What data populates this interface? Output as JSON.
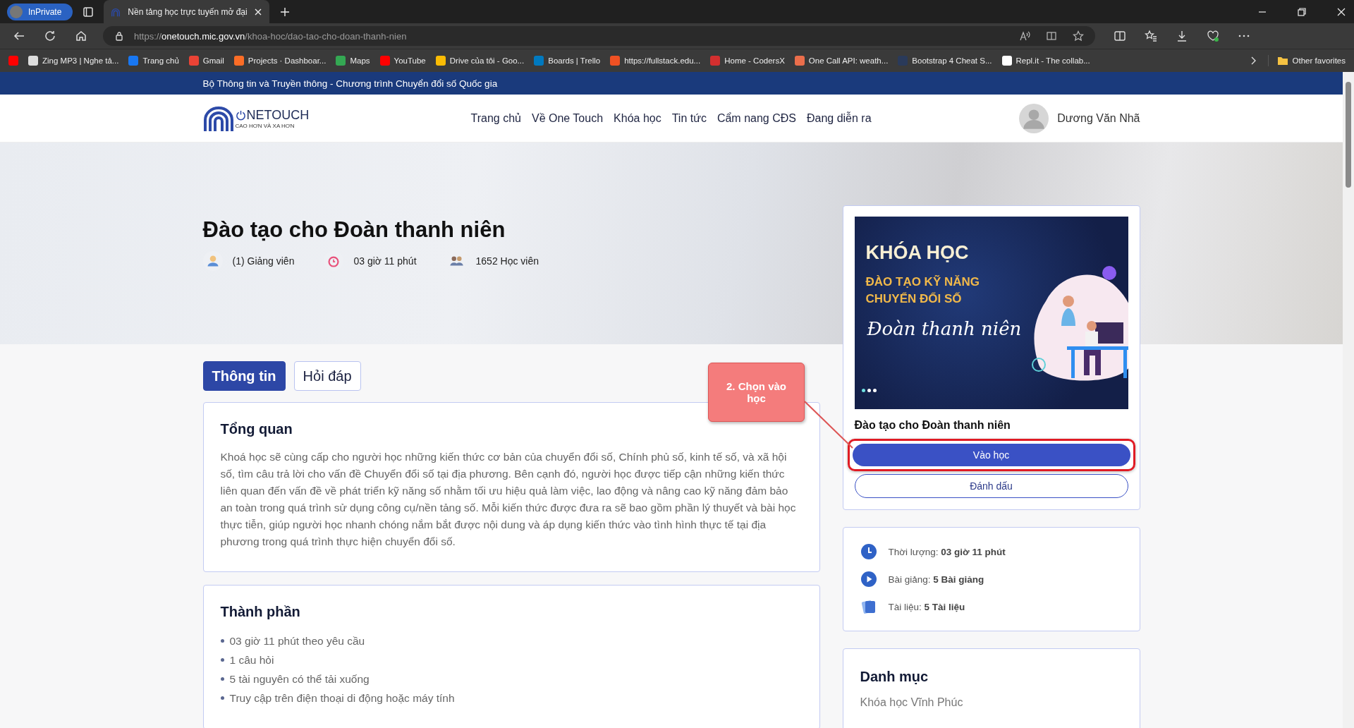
{
  "browser": {
    "private_label": "InPrivate",
    "tab_title": "Nền tảng học trực tuyến mở đại",
    "url_scheme": "https://",
    "url_host": "onetouch.mic.gov.vn",
    "url_path": "/khoa-hoc/dao-tao-cho-doan-thanh-nien",
    "bookmarks": [
      {
        "kind": "youtube"
      },
      {
        "kind": "page",
        "label": "Zing MP3 | Nghe tả..."
      },
      {
        "kind": "facebook",
        "label": "Trang chủ"
      },
      {
        "kind": "gmail",
        "label": "Gmail"
      },
      {
        "kind": "gitlab",
        "label": "Projects · Dashboar..."
      },
      {
        "kind": "maps",
        "label": "Maps"
      },
      {
        "kind": "youtube",
        "label": "YouTube"
      },
      {
        "kind": "drive",
        "label": "Drive của tôi - Goo..."
      },
      {
        "kind": "trello",
        "label": "Boards | Trello"
      },
      {
        "kind": "f8",
        "label": "https://fullstack.edu..."
      },
      {
        "kind": "codersx",
        "label": "Home - CodersX"
      },
      {
        "kind": "weather",
        "label": "One Call API: weath..."
      },
      {
        "kind": "bootstrap",
        "label": "Bootstrap 4 Cheat S..."
      },
      {
        "kind": "replit",
        "label": "Repl.it - The collab..."
      }
    ],
    "other_favorites": "Other favorites"
  },
  "top_banner": "Bộ Thông tin và Truyền thông - Chương trình Chuyển đổi số Quốc gia",
  "site": {
    "logo_text": "NETOUCH",
    "tagline": "CAO HƠN VÀ XA HƠN",
    "nav": [
      "Trang chủ",
      "Về One Touch",
      "Khóa học",
      "Tin tức",
      "Cẩm nang CĐS",
      "Đang diễn ra"
    ],
    "user_name": "Dương Văn Nhã"
  },
  "course": {
    "title": "Đào tạo cho Đoàn thanh niên",
    "meta": [
      {
        "kind": "instructor",
        "text": "(1) Giảng viên"
      },
      {
        "kind": "duration",
        "text": "03 giờ 11 phút"
      },
      {
        "kind": "students",
        "text": "1652 Học viên"
      }
    ]
  },
  "tabs": [
    {
      "label": "Thông tin",
      "selected": true
    },
    {
      "label": "Hỏi đáp",
      "selected": false
    }
  ],
  "overview": {
    "heading": "Tổng quan",
    "body": "Khoá học sẽ cùng cấp cho người học những kiến thức cơ bản của chuyển đổi số, Chính phủ số, kinh tế số, và xã hội số, tìm câu trả lời cho vấn đề Chuyển đổi số tại địa phương. Bên cạnh đó, người học được tiếp cận những kiến thức liên quan đến vấn đề về phát triển kỹ năng số nhằm tối ưu hiệu quả làm việc, lao động và nâng cao kỹ năng đảm bảo an toàn trong quá trình sử dụng công cụ/nền tảng số. Mỗi kiến thức được đưa ra sẽ bao gồm phần lý thuyết và bài học thực tiễn, giúp người học nhanh chóng nắm bắt được nội dung và áp dụng kiến thức vào tình hình thực tế tại địa phương trong quá trình thực hiện chuyển đổi số."
  },
  "components": {
    "heading": "Thành phần",
    "items": [
      "03 giờ 11 phút theo yêu cầu",
      "1 câu hỏi",
      "5 tài nguyên có thể tải xuống",
      "Truy cập trên điện thoại di động hoặc máy tính"
    ]
  },
  "course_card": {
    "image": {
      "heading": "KHÓA HỌC",
      "subtitle": [
        "ĐÀO TẠO KỸ NĂNG",
        "CHUYỂN ĐỔI SỐ"
      ],
      "script": "Đoàn thanh niên"
    },
    "name": "Đào tạo cho Đoàn thanh niên",
    "enter_button": "Vào học",
    "bookmark_button": "Đánh dấu"
  },
  "info": [
    {
      "kind": "duration",
      "label": "Thời lượng:",
      "value": "03 giờ 11 phút"
    },
    {
      "kind": "lectures",
      "label": "Bài giảng:",
      "value": "5 Bài giảng"
    },
    {
      "kind": "documents",
      "label": "Tài liệu:",
      "value": "5 Tài liệu"
    }
  ],
  "category": {
    "heading": "Danh mục",
    "value": "Khóa học Vĩnh Phúc"
  },
  "callout": {
    "text": "2. Chọn vào học"
  }
}
